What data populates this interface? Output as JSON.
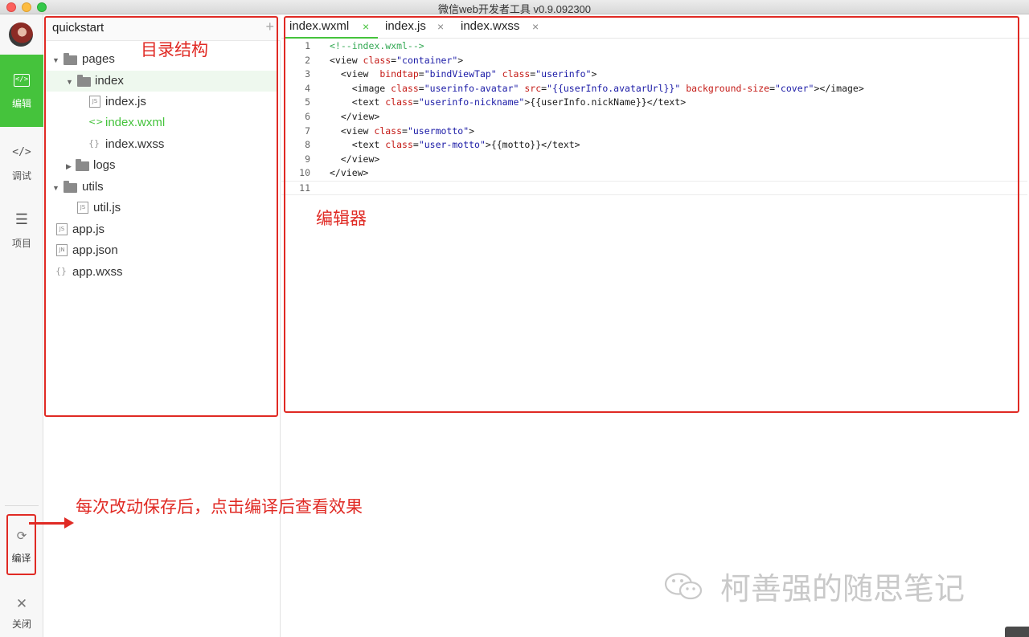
{
  "window": {
    "title": "微信web开发者工具 v0.9.092300"
  },
  "leftnav": {
    "items": [
      {
        "label": "编辑",
        "icon": "code-box-icon",
        "active": true
      },
      {
        "label": "调试",
        "icon": "code-icon"
      },
      {
        "label": "项目",
        "icon": "menu-icon"
      }
    ],
    "compile": {
      "label": "编译",
      "icon": "compile-icon"
    },
    "close": {
      "label": "关闭",
      "icon": "close-icon"
    }
  },
  "filepanel": {
    "project": "quickstart",
    "add_icon": "plus-icon",
    "tree": [
      {
        "name": "pages",
        "type": "folder",
        "expanded": true
      },
      {
        "name": "index",
        "type": "folder",
        "expanded": true,
        "active": true
      },
      {
        "name": "index.js",
        "type": "file",
        "badge": "JS"
      },
      {
        "name": "index.wxml",
        "type": "file",
        "badge": "<>",
        "highlight": true
      },
      {
        "name": "index.wxss",
        "type": "file",
        "badge": "{}"
      },
      {
        "name": "logs",
        "type": "folder",
        "expanded": false
      },
      {
        "name": "utils",
        "type": "folder",
        "expanded": true
      },
      {
        "name": "util.js",
        "type": "file",
        "badge": "JS"
      },
      {
        "name": "app.js",
        "type": "file",
        "badge": "JS"
      },
      {
        "name": "app.json",
        "type": "file",
        "badge": "JN"
      },
      {
        "name": "app.wxss",
        "type": "file",
        "badge": "{}"
      }
    ]
  },
  "editor": {
    "tabs": [
      {
        "label": "index.wxml",
        "close": "×",
        "active": true
      },
      {
        "label": "index.js",
        "close": "×"
      },
      {
        "label": "index.wxss",
        "close": "×"
      }
    ],
    "lines": [
      [
        {
          "t": "<!--index.wxml-->",
          "c": "cm"
        }
      ],
      [
        {
          "t": "<view ",
          "c": "tg"
        },
        {
          "t": "class",
          "c": "at"
        },
        {
          "t": "=",
          "c": "tg"
        },
        {
          "t": "\"container\"",
          "c": "st"
        },
        {
          "t": ">",
          "c": "tg"
        }
      ],
      [
        {
          "t": "  <view  ",
          "c": "tg"
        },
        {
          "t": "bindtap",
          "c": "at"
        },
        {
          "t": "=",
          "c": "tg"
        },
        {
          "t": "\"bindViewTap\"",
          "c": "st"
        },
        {
          "t": " ",
          "c": "tg"
        },
        {
          "t": "class",
          "c": "at"
        },
        {
          "t": "=",
          "c": "tg"
        },
        {
          "t": "\"userinfo\"",
          "c": "st"
        },
        {
          "t": ">",
          "c": "tg"
        }
      ],
      [
        {
          "t": "    <image ",
          "c": "tg"
        },
        {
          "t": "class",
          "c": "at"
        },
        {
          "t": "=",
          "c": "tg"
        },
        {
          "t": "\"userinfo-avatar\"",
          "c": "st"
        },
        {
          "t": " ",
          "c": "tg"
        },
        {
          "t": "src",
          "c": "at"
        },
        {
          "t": "=",
          "c": "tg"
        },
        {
          "t": "\"{{userInfo.avatarUrl}}\"",
          "c": "st"
        },
        {
          "t": " ",
          "c": "tg"
        },
        {
          "t": "background-size",
          "c": "at"
        },
        {
          "t": "=",
          "c": "tg"
        },
        {
          "t": "\"cover\"",
          "c": "st"
        },
        {
          "t": "></image>",
          "c": "tg"
        }
      ],
      [
        {
          "t": "    <text ",
          "c": "tg"
        },
        {
          "t": "class",
          "c": "at"
        },
        {
          "t": "=",
          "c": "tg"
        },
        {
          "t": "\"userinfo-nickname\"",
          "c": "st"
        },
        {
          "t": ">{{userInfo.nickName}}</text>",
          "c": "tg"
        }
      ],
      [
        {
          "t": "  </view>",
          "c": "tg"
        }
      ],
      [
        {
          "t": "  <view ",
          "c": "tg"
        },
        {
          "t": "class",
          "c": "at"
        },
        {
          "t": "=",
          "c": "tg"
        },
        {
          "t": "\"usermotto\"",
          "c": "st"
        },
        {
          "t": ">",
          "c": "tg"
        }
      ],
      [
        {
          "t": "    <text ",
          "c": "tg"
        },
        {
          "t": "class",
          "c": "at"
        },
        {
          "t": "=",
          "c": "tg"
        },
        {
          "t": "\"user-motto\"",
          "c": "st"
        },
        {
          "t": ">{{motto}}</text>",
          "c": "tg"
        }
      ],
      [
        {
          "t": "  </view>",
          "c": "tg"
        }
      ],
      [
        {
          "t": "</view>",
          "c": "tg"
        }
      ],
      []
    ]
  },
  "annotations": {
    "tree_label": "目录结构",
    "editor_label": "编辑器",
    "compile_hint": "每次改动保存后，点击编译后查看效果",
    "accent": "#e02a24"
  },
  "watermark": {
    "text": "柯善强的随思笔记",
    "icon": "wechat-icon"
  }
}
